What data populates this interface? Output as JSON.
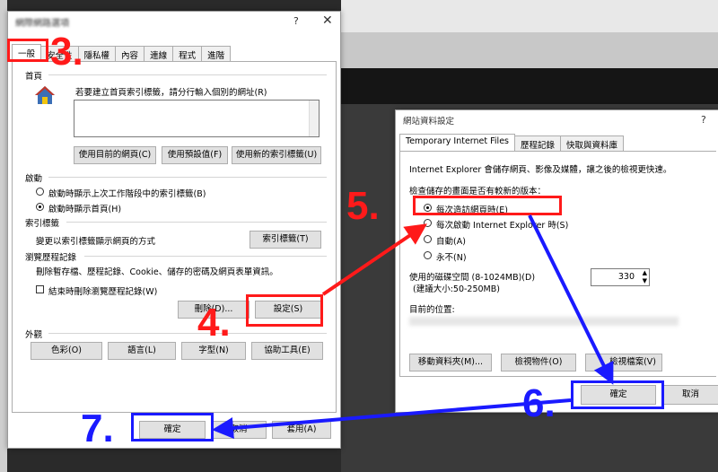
{
  "colors": {
    "red": "#ff1a1a",
    "blue": "#1a1aff"
  },
  "internet_options": {
    "title": "網際網路選項",
    "help": "?",
    "close": "✕",
    "tabs": [
      "一般",
      "安全性",
      "隱私權",
      "內容",
      "連線",
      "程式",
      "進階"
    ],
    "home_page": {
      "label": "首頁",
      "description": "若要建立首頁索引標籤，請分行輸入個別的網址(R)",
      "btn_current": "使用目前的網頁(C)",
      "btn_default": "使用預設值(F)",
      "btn_new_tab": "使用新的索引標籤(U)"
    },
    "startup": {
      "label": "啟動",
      "opt_last_session": "啟動時顯示上次工作階段中的索引標籤(B)",
      "opt_home_page": "啟動時顯示首頁(H)"
    },
    "tabs_section": {
      "label": "索引標籤",
      "description": "變更以索引標籤顯示網頁的方式",
      "btn": "索引標籤(T)"
    },
    "history": {
      "label": "瀏覽歷程記錄",
      "description": "刪除暫存檔、歷程記錄、Cookie、儲存的密碼及網頁表單資訊。",
      "checkbox": "結束時刪除瀏覽歷程記錄(W)",
      "btn_delete": "刪除(D)...",
      "btn_settings": "設定(S)"
    },
    "appearance": {
      "label": "外觀",
      "btn_colors": "色彩(O)",
      "btn_languages": "語言(L)",
      "btn_fonts": "字型(N)",
      "btn_accessibility": "協助工具(E)"
    },
    "footer": {
      "ok": "確定",
      "cancel": "取消",
      "apply": "套用(A)"
    }
  },
  "website_data": {
    "title": "網站資料設定",
    "help": "?",
    "tabs": [
      "Temporary Internet Files",
      "歷程記錄",
      "快取與資料庫"
    ],
    "description": "Internet Explorer 會儲存網頁、影像及媒體，讓之後的檢視更快速。",
    "check_label": "檢查儲存的畫面是否有較新的版本：",
    "opt_every_visit": "每次造訪網頁時(E)",
    "opt_every_start": "每次啟動 Internet Explorer 時(S)",
    "opt_auto": "自動(A)",
    "opt_never": "永不(N)",
    "disk_label": "使用的磁碟空間 (8-1024MB)(D)",
    "disk_recommended": "(建議大小:50-250MB)",
    "disk_value": "330",
    "location_label": "目前的位置:",
    "btn_move": "移動資料夾(M)...",
    "btn_view_objects": "檢視物件(O)",
    "btn_view_files": "檢視檔案(V)",
    "ok": "確定",
    "cancel": "取消"
  },
  "steps": {
    "s3": "3.",
    "s4": "4.",
    "s5": "5.",
    "s6": "6.",
    "s7": "7."
  }
}
